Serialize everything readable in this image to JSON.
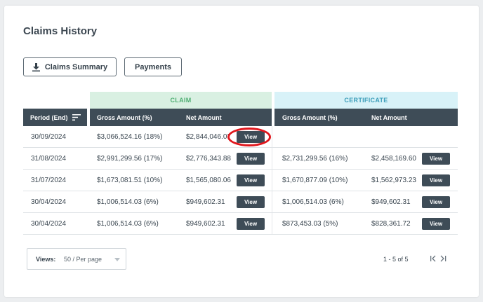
{
  "page": {
    "title": "Claims History"
  },
  "toolbar": {
    "summary_label": "Claims Summary",
    "payments_label": "Payments"
  },
  "groups": {
    "claim": "CLAIM",
    "certificate": "CERTIFICATE"
  },
  "columns": {
    "period": "Period (End)",
    "claim_gross": "Gross Amount (%)",
    "claim_net": "Net Amount",
    "cert_gross": "Gross Amount (%)",
    "cert_net": "Net Amount"
  },
  "view_label": "View",
  "rows": [
    {
      "period": "30/09/2024",
      "claim_gross": "$3,066,524.16 (18%)",
      "claim_net": "$2,844,046.07",
      "cert_gross": "",
      "cert_net": ""
    },
    {
      "period": "31/08/2024",
      "claim_gross": "$2,991,299.56 (17%)",
      "claim_net": "$2,776,343.88",
      "cert_gross": "$2,731,299.56 (16%)",
      "cert_net": "$2,458,169.60"
    },
    {
      "period": "31/07/2024",
      "claim_gross": "$1,673,081.51 (10%)",
      "claim_net": "$1,565,080.06",
      "cert_gross": "$1,670,877.09 (10%)",
      "cert_net": "$1,562,973.23"
    },
    {
      "period": "30/04/2024",
      "claim_gross": "$1,006,514.03 (6%)",
      "claim_net": "$949,602.31",
      "cert_gross": "$1,006,514.03 (6%)",
      "cert_net": "$949,602.31"
    },
    {
      "period": "30/04/2024",
      "claim_gross": "$1,006,514.03 (6%)",
      "claim_net": "$949,602.31",
      "cert_gross": "$873,453.03 (5%)",
      "cert_net": "$828,361.72"
    }
  ],
  "pagination": {
    "views_label": "Views:",
    "per_page": "50 / Per page",
    "range": "1 - 5  of  5"
  },
  "colors": {
    "header_bg": "#3e4c57",
    "claim_bg": "#d9f0e2",
    "certificate_bg": "#d8f2f8",
    "highlight": "#e0161c"
  },
  "icons": {
    "download": "download-icon",
    "sort": "sort-icon",
    "caret": "chevron-down-icon",
    "pager": "first-last-page-icon"
  }
}
